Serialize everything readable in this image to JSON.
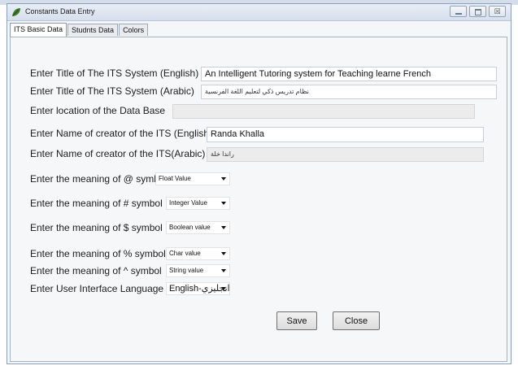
{
  "window": {
    "title": "Constants Data Entry"
  },
  "tabs": [
    {
      "label": "ITS Basic Data",
      "active": true
    },
    {
      "label": "Studnts Data",
      "active": false
    },
    {
      "label": "Colors",
      "active": false
    }
  ],
  "form": {
    "title_en": {
      "label": "Enter Title of The ITS System (English)",
      "value": "An Intelligent Tutoring  system for  Teaching  learne French"
    },
    "title_ar": {
      "label": "Enter Title of The ITS System (Arabic)",
      "value": "نظام تدريس ذكي لتعليم اللغة الفرنسية"
    },
    "db_location": {
      "label": "Enter location of the Data Base",
      "value": ""
    },
    "creator_en": {
      "label": "Enter Name of creator of the ITS (English)",
      "value": "Randa Khalla"
    },
    "creator_ar": {
      "label": "Enter Name of creator of the ITS(Arabic)",
      "value": "راندا خلة"
    },
    "symbols": [
      {
        "label": "Enter the meaning of @ symbol",
        "value": "Float Value"
      },
      {
        "label": "Enter the meaning of # symbol",
        "value": "Integer Value"
      },
      {
        "label": "Enter the meaning of $ symbol",
        "value": "Boolean value"
      },
      {
        "label": "Enter the meaning of % symbol",
        "value": "Char value"
      },
      {
        "label": "Enter the meaning of ^ symbol",
        "value": "String value"
      }
    ],
    "ui_language": {
      "label": "Enter User Interface Language",
      "value": "English-انجليزي"
    }
  },
  "buttons": {
    "save": "Save",
    "close": "Close"
  },
  "caption_buttons": {
    "minimize_icon": "minimize-icon",
    "maximize_icon": "maximize-icon",
    "close_glyph": "☒"
  },
  "colors": {
    "window_border": "#8aa0bd",
    "titlebar": "#dfe6f0",
    "panel_bg": "#f6f7f9"
  }
}
